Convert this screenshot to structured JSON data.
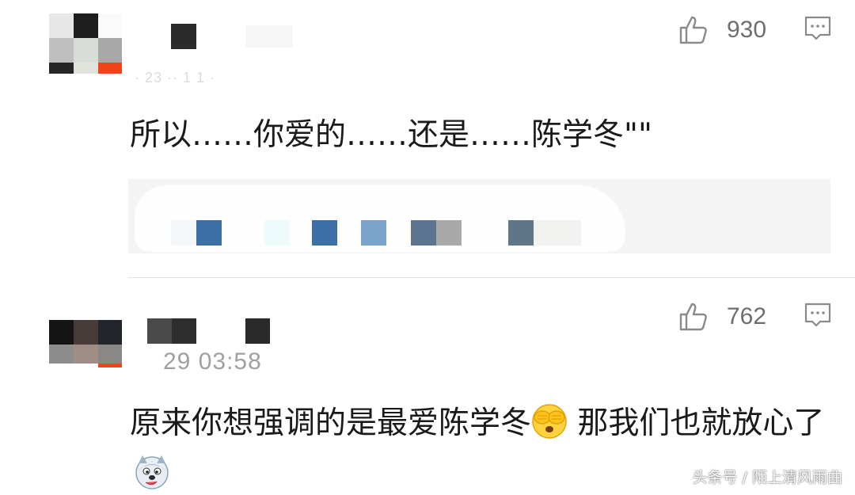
{
  "comments": [
    {
      "meta": "· 23 ·· 1 1 ·",
      "text": "所以……你爱的……还是……陈学冬\"\"",
      "likes": "930",
      "like_icon": "thumbs-up-icon",
      "reply_icon": "comment-icon"
    },
    {
      "meta": "29 03:58",
      "text_prefix": "原来你想强调的是最爱陈学冬",
      "text_suffix": " 那我们也就放心了",
      "emoji_1": "covering-eyes-emoji",
      "emoji_2": "husky-emoji",
      "likes": "762",
      "like_icon": "thumbs-up-icon",
      "reply_icon": "comment-icon"
    }
  ],
  "watermark": "头条号 / 陌上清风雨曲",
  "colors": {
    "text": "#1a1a1a",
    "muted": "#9a9a9a",
    "icon": "#8a8a8a",
    "card_bg": "#f4f4f4"
  }
}
